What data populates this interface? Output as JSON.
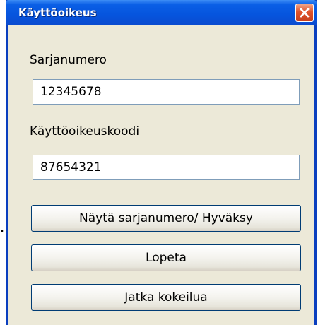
{
  "stray_text": ".",
  "window": {
    "title": "Käyttöoikeus"
  },
  "form": {
    "serial_label": "Sarjanumero",
    "serial_value": "12345678",
    "code_label": "Käyttöoikeuskoodi",
    "code_value": "87654321"
  },
  "buttons": {
    "show_accept": "Näytä sarjanumero/ Hyväksy",
    "quit": "Lopeta",
    "continue_trial": "Jatka kokeilua"
  },
  "colors": {
    "titlebar": "#0654dd",
    "window_bg": "#ece9d8",
    "close_button": "#e0532c"
  },
  "icons": {
    "close": "close-icon"
  }
}
